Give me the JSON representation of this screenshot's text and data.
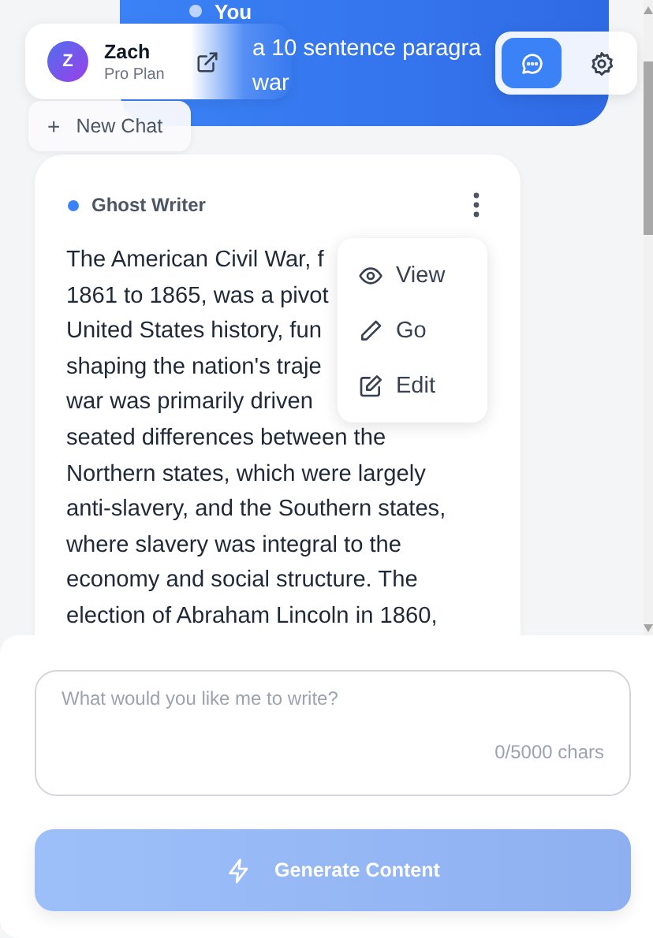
{
  "user_message": {
    "author": "You",
    "lines": [
      "a 10 sentence paragra",
      "war"
    ]
  },
  "profile": {
    "initial": "Z",
    "name": "Zach",
    "plan": "Pro Plan"
  },
  "new_chat": {
    "icon": "+",
    "label": "New Chat"
  },
  "mode_buttons": [
    {
      "kind": "chat",
      "selected": true
    },
    {
      "kind": "settings",
      "selected": false
    }
  ],
  "message": {
    "author": "Ghost Writer",
    "lines": [
      "The American Civil War, f",
      "1861 to 1865, was a pivot",
      "United States history, fun",
      "shaping the nation's traje",
      "war was primarily driven",
      "seated differences between the",
      "Northern states, which were largely",
      "anti-slavery, and the Southern states,",
      "where slavery was integral to the",
      "economy and social structure. The",
      "election of Abraham Lincoln in 1860,"
    ]
  },
  "menu": [
    {
      "kind": "view",
      "label": "View"
    },
    {
      "kind": "go",
      "label": "Go"
    },
    {
      "kind": "edit",
      "label": "Edit"
    }
  ],
  "composer": {
    "placeholder": "What would you like me to write?",
    "counter": "0/5000 chars"
  },
  "generate_button": {
    "label": "Generate Content",
    "disabled": true
  }
}
